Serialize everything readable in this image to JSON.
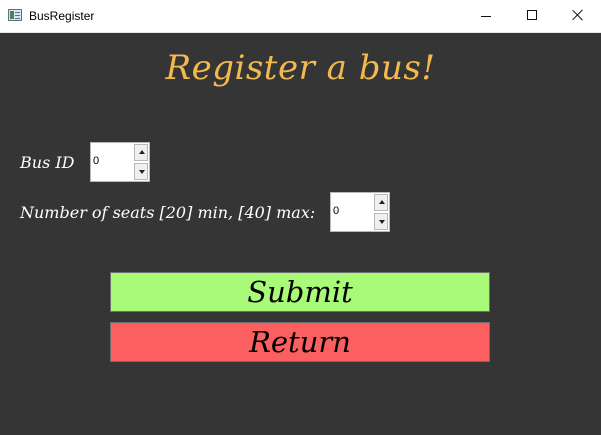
{
  "window": {
    "title": "BusRegister",
    "icon": "app-window-icon",
    "controls": {
      "minimize": "minimize-icon",
      "maximize": "maximize-icon",
      "close": "close-icon"
    }
  },
  "form": {
    "heading": "Register a bus!",
    "bus_id": {
      "label": "Bus ID",
      "value": "0"
    },
    "seats": {
      "label": "Number of seats [20] min, [40] max:",
      "value": "0"
    }
  },
  "actions": {
    "submit": "Submit",
    "return": "Return"
  },
  "colors": {
    "background": "#353535",
    "heading": "#f2b94f",
    "submit": "#a8fa78",
    "return": "#fb5f5f"
  }
}
